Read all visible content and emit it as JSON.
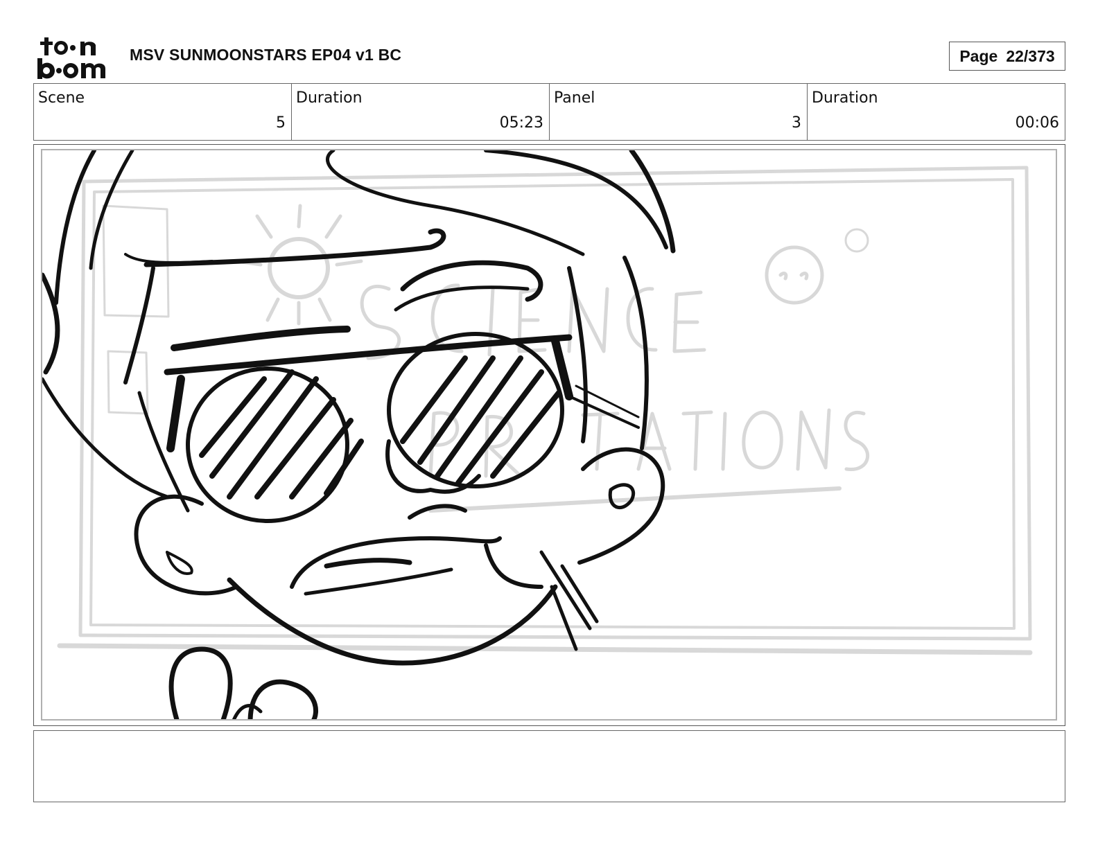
{
  "header": {
    "logo_text": "toonboom",
    "project_title": "MSV SUNMOONSTARS EP04 v1 BC",
    "page_label": "Page",
    "page_value": "22/373"
  },
  "info": {
    "scene_label": "Scene",
    "scene_value": "5",
    "scene_duration_label": "Duration",
    "scene_duration_value": "05:23",
    "panel_label": "Panel",
    "panel_value": "3",
    "panel_duration_label": "Duration",
    "panel_duration_value": "00:06"
  },
  "drawing": {
    "background_lettering": "SCIENCE PRESENTATIONS",
    "ink_color": "#111111",
    "sketch_color": "#d8d8d8"
  },
  "notes": {
    "text": ""
  }
}
